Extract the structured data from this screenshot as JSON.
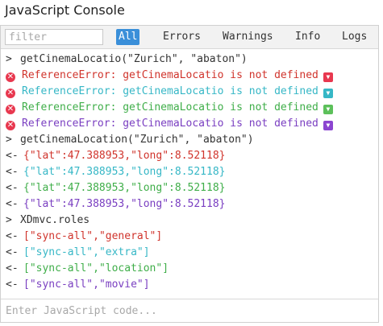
{
  "window": {
    "title": "JavaScript Console"
  },
  "toolbar": {
    "filter_placeholder": "filter",
    "tabs": [
      {
        "label": "All",
        "active": true
      },
      {
        "label": "Errors",
        "active": false
      },
      {
        "label": "Warnings",
        "active": false
      },
      {
        "label": "Info",
        "active": false
      },
      {
        "label": "Logs",
        "active": false
      }
    ]
  },
  "colors": {
    "red": "#d0342c",
    "teal": "#36b7c6",
    "green": "#3fae49",
    "purple": "#7a3fc1",
    "active_tab": "#3a8fd9"
  },
  "console": {
    "commands": {
      "cmd1": "getCinemaLocatio(\"Zurich\", \"abaton\")",
      "cmd2": "getCinemaLocation(\"Zurich\", \"abaton\")",
      "cmd3": "XDmvc.roles"
    },
    "prompt_in": ">",
    "prompt_out": "<-",
    "error_text": "ReferenceError: getCinemaLocatio is not defined",
    "location_result": {
      "open": "{",
      "lat_key": "\"lat\"",
      "colon": ":",
      "lat_val": "47.388953",
      "comma": ",",
      "long_key": "\"long\"",
      "long_val": "8.52118",
      "close": "}"
    },
    "roles_results": [
      {
        "open": "[",
        "first": "\"sync-all\"",
        "comma": ",",
        "second": "\"general\"",
        "close": "]"
      },
      {
        "open": "[",
        "first": "\"sync-all\"",
        "comma": ",",
        "second": "\"extra\"",
        "close": "]"
      },
      {
        "open": "[",
        "first": "\"sync-all\"",
        "comma": ",",
        "second": "\"location\"",
        "close": "]"
      },
      {
        "open": "[",
        "first": "\"sync-all\"",
        "comma": ",",
        "second": "\"movie\"",
        "close": "]"
      }
    ]
  },
  "input": {
    "placeholder": "Enter JavaScript code..."
  }
}
